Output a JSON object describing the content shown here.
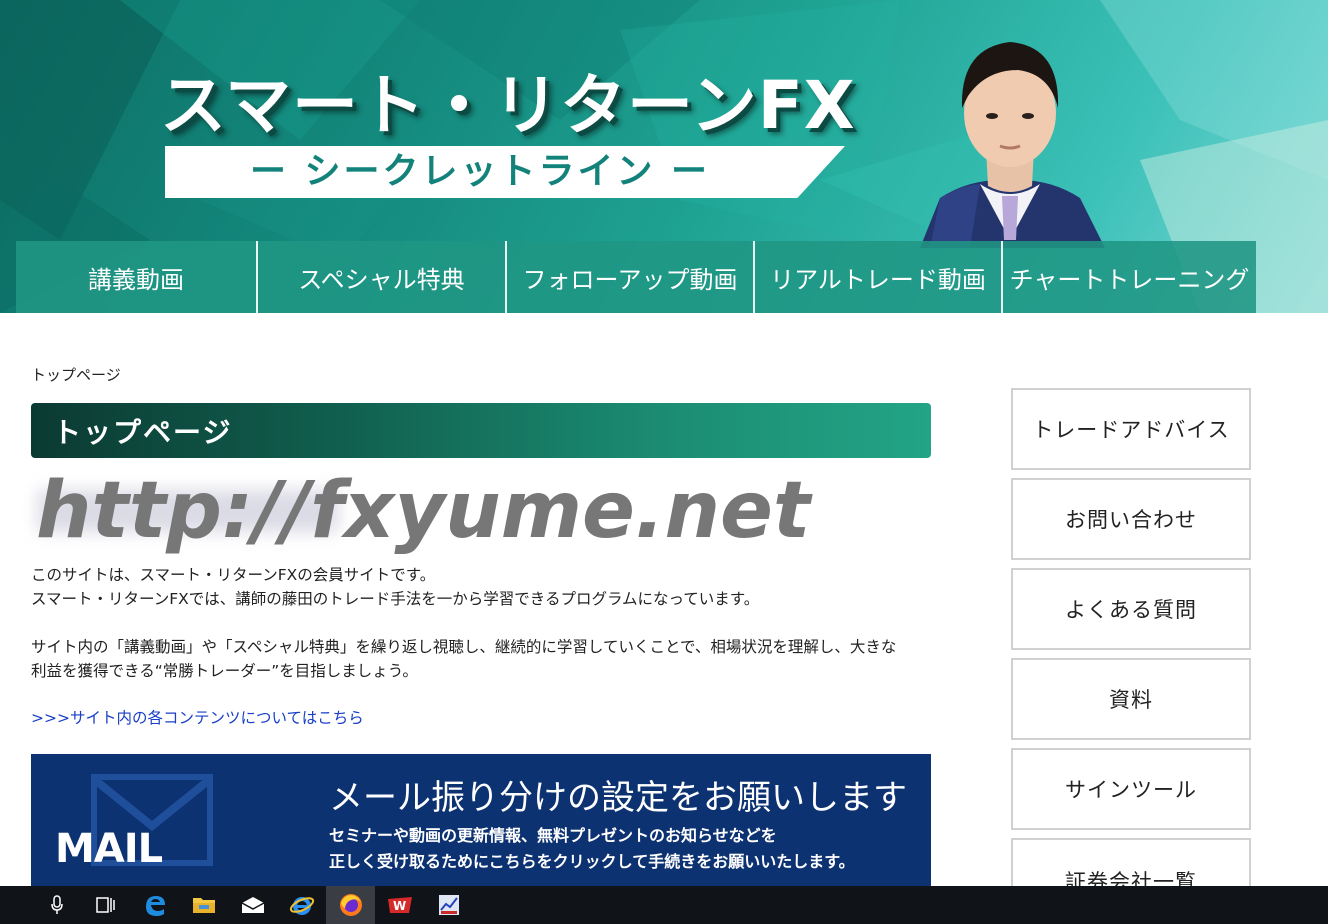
{
  "header": {
    "title": "スマート・リターンFX",
    "subtitle": "ー シークレットライン ー"
  },
  "nav": {
    "items": [
      {
        "label": "講義動画"
      },
      {
        "label": "スペシャル特典"
      },
      {
        "label": "フォローアップ動画"
      },
      {
        "label": "リアルトレード動画"
      },
      {
        "label": "チャートトレーニング"
      }
    ]
  },
  "breadcrumb": "トップページ",
  "page_title": "トップページ",
  "watermark": "http://fxyume.net",
  "content": {
    "p1_line1": "このサイトは、スマート・リターンFXの会員サイトです。",
    "p1_line2": "スマート・リターンFXでは、講師の藤田のトレード手法を一から学習できるプログラムになっています。",
    "p2_line1": "サイト内の「講義動画」や「スペシャル特典」を繰り返し視聴し、継続的に学習していくことで、相場状況を理解し、大きな",
    "p2_line2": "利益を獲得できる“常勝トレーダー”を目指しましょう。",
    "link": ">>>サイト内の各コンテンツについてはこちら"
  },
  "mail_banner": {
    "label": "MAIL",
    "title": "メール振り分けの設定をお願いします",
    "desc_line1": "セミナーや動画の更新情報、無料プレゼントのお知らせなどを",
    "desc_line2": "正しく受け取るためにこちらをクリックして手続きをお願いいたします。"
  },
  "sidebar": {
    "items": [
      {
        "label": "トレードアドバイス"
      },
      {
        "label": "お問い合わせ"
      },
      {
        "label": "よくある質問"
      },
      {
        "label": "資料"
      },
      {
        "label": "サインツール"
      },
      {
        "label": "証券会社一覧"
      }
    ]
  },
  "taskbar": {
    "icons": [
      "microphone-icon",
      "task-view-icon",
      "edge-icon",
      "file-explorer-icon",
      "mail-icon",
      "internet-explorer-icon",
      "firefox-icon",
      "app-w-icon",
      "app-chart-icon"
    ]
  },
  "colors": {
    "header_teal": "#1fa393",
    "title_bar": "#11604f",
    "mail_banner_bg": "#0d3272",
    "link": "#1a3fc7",
    "taskbar": "#101318"
  }
}
